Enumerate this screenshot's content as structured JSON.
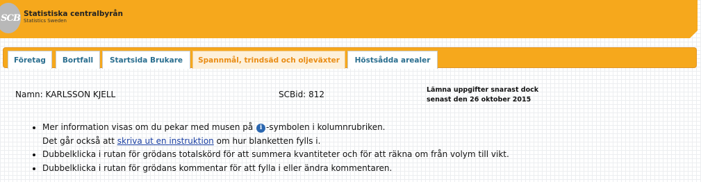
{
  "header": {
    "logo_text": "SCB",
    "org_name": "Statistiska centralbyrån",
    "org_sub": "Statistics Sweden",
    "brand_color": "#f6a81c"
  },
  "tabs": [
    {
      "label": "Företag",
      "active": false
    },
    {
      "label": "Bortfall",
      "active": false
    },
    {
      "label": "Startsida Brukare",
      "active": false
    },
    {
      "label": "Spannmål, trindsäd och oljeväxter",
      "active": true
    },
    {
      "label": "Höstsådda arealer",
      "active": false
    }
  ],
  "respondent": {
    "name_label": "Namn:",
    "name": "KARLSSON KJELL",
    "scbid_label": "SCBid:",
    "scbid": "812"
  },
  "deadline": {
    "line1": "Lämna uppgifter snarast dock",
    "line2": "senast den 26 oktober 2015"
  },
  "instructions": {
    "item1_before": "Mer information visas om du pekar med musen på ",
    "item1_icon": "info-icon",
    "item1_after": "-symbolen i kolumnrubriken.",
    "item1_line2_before": "Det går också att ",
    "item1_link": "skriva ut en instruktion",
    "item1_line2_after": " om hur blanketten fylls i.",
    "item2": "Dubbelklicka i rutan för grödans totalskörd för att summera kvantiteter och för att räkna om från volym till vikt.",
    "item3": "Dubbelklicka i rutan för grödans kommentar för att fylla i eller ändra kommentaren."
  }
}
